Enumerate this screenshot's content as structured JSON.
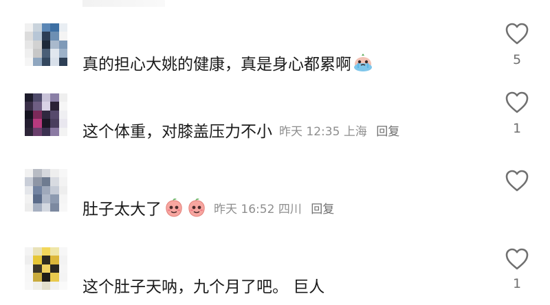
{
  "comments": [
    {
      "username": "",
      "text": "真的担心大姚的健康，真是身心都累啊",
      "time": "",
      "location": "",
      "reply": "",
      "likes": "5",
      "emoji": "crying-face"
    },
    {
      "username": "",
      "text": "这个体重，对膝盖压力不小",
      "time": "昨天 12:35",
      "location": "上海",
      "reply": "回复",
      "likes": "1"
    },
    {
      "username": "",
      "text": "肚子太大了",
      "time": "昨天 16:52",
      "location": "四川",
      "reply": "回复",
      "likes": "",
      "emoji": "peach-face"
    },
    {
      "username": "",
      "text": "这个肚子天呐，九个月了吧。 巨人",
      "time": "",
      "location": "",
      "reply": "",
      "likes": "1"
    }
  ],
  "icons": {
    "like": "heart-outline-icon"
  },
  "colors": {
    "text": "#1a1a1a",
    "meta": "#8e8e8e",
    "icon": "#6f6f6f"
  }
}
